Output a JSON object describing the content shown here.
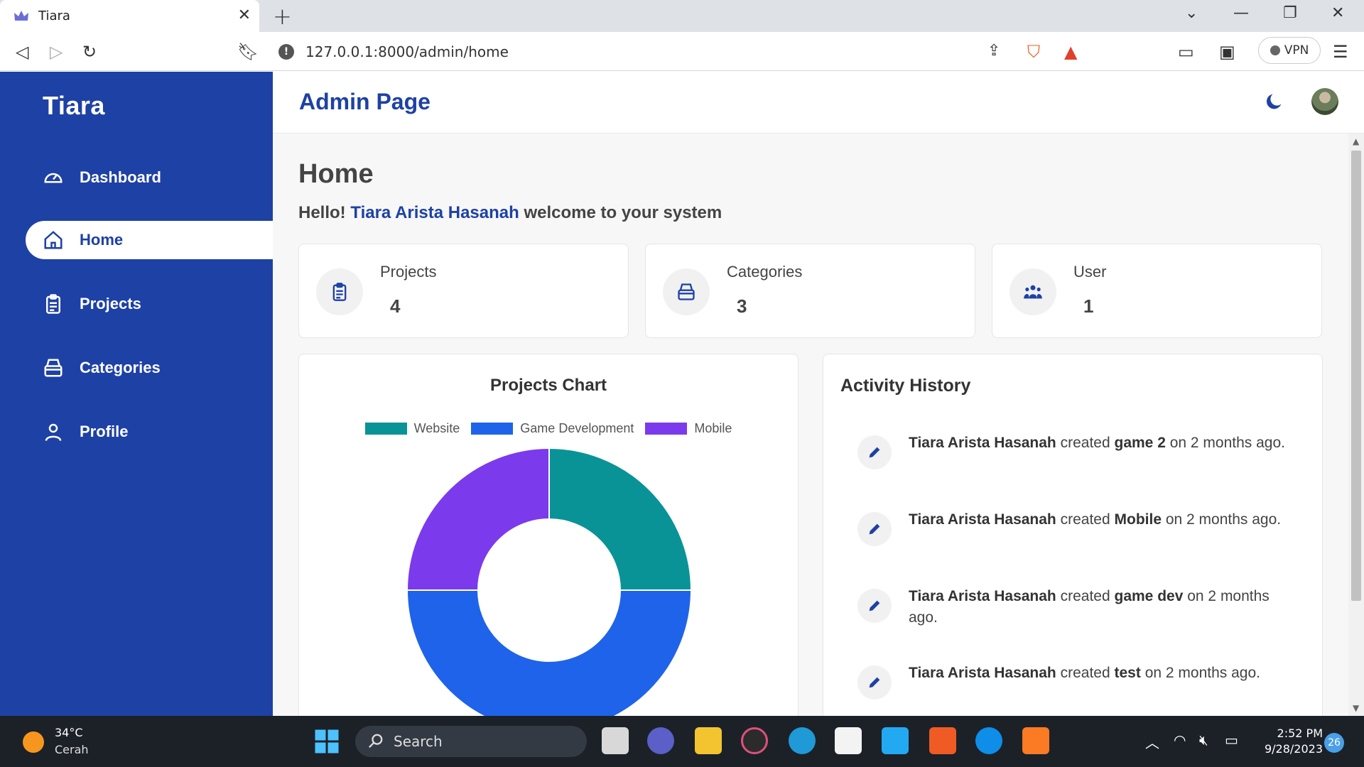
{
  "browser": {
    "tab_title": "Tiara",
    "url": "127.0.0.1:8000/admin/home",
    "vpn_label": "VPN"
  },
  "sidebar": {
    "brand": "Tiara",
    "items": [
      {
        "label": "Dashboard",
        "icon": "gauge-icon"
      },
      {
        "label": "Home",
        "icon": "home-icon",
        "active": true
      },
      {
        "label": "Projects",
        "icon": "clipboard-icon"
      },
      {
        "label": "Categories",
        "icon": "box-icon"
      },
      {
        "label": "Profile",
        "icon": "user-icon"
      }
    ]
  },
  "header": {
    "title": "Admin Page"
  },
  "main": {
    "heading": "Home",
    "greeting_prefix": "Hello!",
    "user_name": "Tiara Arista Hasanah",
    "greeting_suffix": "welcome to your system",
    "stats": [
      {
        "label": "Projects",
        "value": "4",
        "icon": "clipboard-icon"
      },
      {
        "label": "Categories",
        "value": "3",
        "icon": "box-icon"
      },
      {
        "label": "User",
        "value": "1",
        "icon": "users-icon"
      }
    ],
    "chart_title": "Projects Chart",
    "activity_title": "Activity History",
    "activities": [
      {
        "user": "Tiara Arista Hasanah",
        "verb": "created",
        "item": "game 2",
        "time": "on 2 months ago."
      },
      {
        "user": "Tiara Arista Hasanah",
        "verb": "created",
        "item": "Mobile",
        "time": "on 2 months ago."
      },
      {
        "user": "Tiara Arista Hasanah",
        "verb": "created",
        "item": "game dev",
        "time": "on 2 months ago."
      },
      {
        "user": "Tiara Arista Hasanah",
        "verb": "created",
        "item": "test",
        "time": "on 2 months ago."
      }
    ]
  },
  "chart_data": {
    "type": "pie",
    "subtype": "doughnut",
    "title": "Projects Chart",
    "categories": [
      "Website",
      "Game Development",
      "Mobile"
    ],
    "values": [
      1,
      2,
      1
    ],
    "colors": [
      "#0a9396",
      "#1e63ea",
      "#7c3aed"
    ],
    "legend": "top"
  },
  "taskbar": {
    "temp": "34°C",
    "weather": "Cerah",
    "search_label": "Search",
    "time": "2:52 PM",
    "date": "9/28/2023",
    "notifications": "26"
  }
}
